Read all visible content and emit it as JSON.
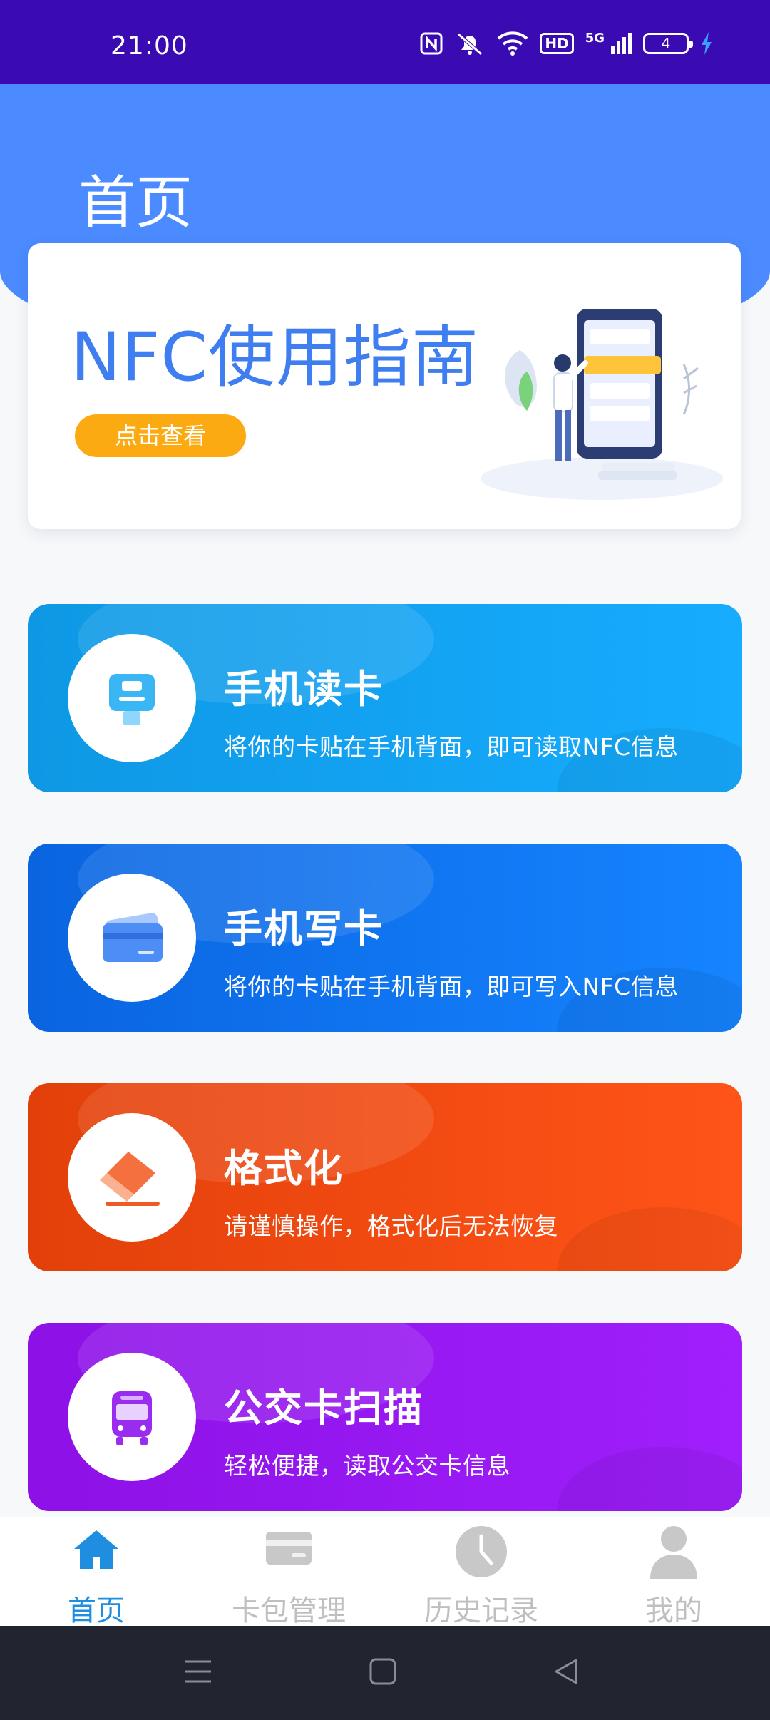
{
  "status_bar": {
    "time": "21:00",
    "network_label": "5G",
    "hd_label": "HD",
    "battery_level": "4"
  },
  "header": {
    "title": "首页"
  },
  "guide_banner": {
    "title": "NFC使用指南",
    "button_label": "点击查看"
  },
  "features": [
    {
      "title": "手机读卡",
      "desc": "将你的卡贴在手机背面，即可读取NFC信息",
      "icon": "card-reader-icon",
      "color": "#17acff"
    },
    {
      "title": "手机写卡",
      "desc": "将你的卡贴在手机背面，即可写入NFC信息",
      "icon": "card-icon",
      "color": "#1684ff"
    },
    {
      "title": "格式化",
      "desc": "请谨慎操作，格式化后无法恢复",
      "icon": "eraser-icon",
      "color": "#ff5418"
    },
    {
      "title": "公交卡扫描",
      "desc": "轻松便捷，读取公交卡信息",
      "icon": "bus-icon",
      "color": "#a01ffc"
    }
  ],
  "tabs": [
    {
      "label": "首页",
      "icon": "home-icon",
      "active": true
    },
    {
      "label": "卡包管理",
      "icon": "wallet-icon",
      "active": false
    },
    {
      "label": "历史记录",
      "icon": "clock-icon",
      "active": false
    },
    {
      "label": "我的",
      "icon": "user-icon",
      "active": false
    }
  ],
  "colors": {
    "status_bar": "#3a0bb3",
    "header": "#4b8bff",
    "accent_orange": "#fbaa12",
    "tab_active": "#1f8ee0",
    "tab_inactive": "#bfbfbf"
  }
}
